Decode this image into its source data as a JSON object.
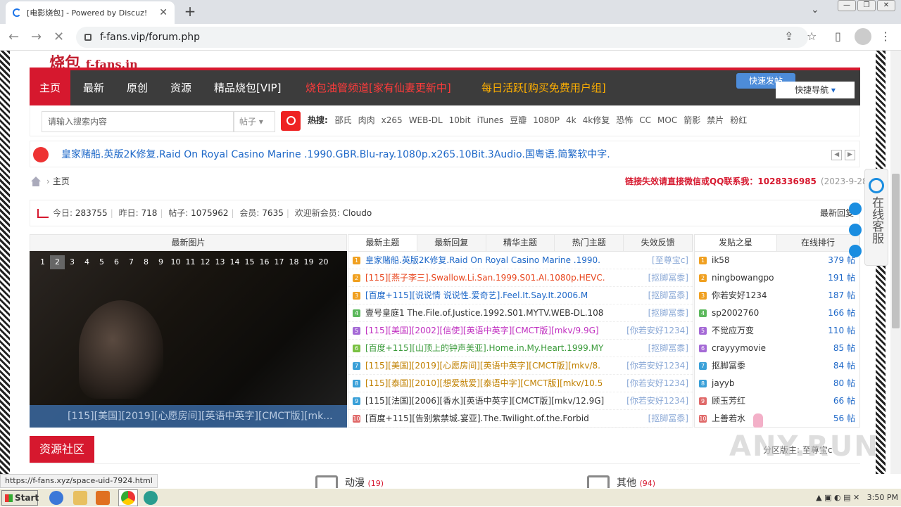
{
  "browser": {
    "tab_title": "[电影烧包] - Powered by Discuz!",
    "url": "f-fans.vip/forum.php",
    "status_url": "https://f-fans.xyz/space-uid-7924.html"
  },
  "site": {
    "logo_cn": "烧包",
    "logo_en": "f-fans.in"
  },
  "nav": {
    "items": [
      "主页",
      "最新",
      "原创",
      "资源",
      "精品烧包[VIP]"
    ],
    "promo1": "烧包油管频道[家有仙妻更新中]",
    "promo2": "每日活跃[购买免费用户组]",
    "quick_post": "快速发帖",
    "quick_nav": "快捷导航"
  },
  "search": {
    "placeholder": "请输入搜索内容",
    "type": "帖子",
    "hot_label": "热搜:",
    "hot": [
      "邵氏",
      "肉肉",
      "x265",
      "WEB-DL",
      "10bit",
      "iTunes",
      "豆瓣",
      "1080P",
      "4k",
      "4k修复",
      "恐怖",
      "CC",
      "MOC",
      "箭影",
      "禁片",
      "粉红"
    ]
  },
  "notice": "皇家赌船.英版2K修复.Raid On Royal Casino Marine .1990.GBR.Blu-ray.1080p.x265.10Bit.3Audio.国粤语.简繁软中字.",
  "breadcrumb": "主页",
  "contact": {
    "text": "链接失效请直接微信或QQ联系我：1028336985",
    "date": "(2023-9-28)"
  },
  "stats": {
    "today_label": "今日:",
    "today": "283755",
    "yesterday_label": "昨日:",
    "yesterday": "718",
    "posts_label": "帖子:",
    "posts": "1075962",
    "members_label": "会员:",
    "members": "7635",
    "welcome_label": "欢迎新会员:",
    "welcome": "Cloudo",
    "right": "最新回复"
  },
  "pics": {
    "header": "最新图片",
    "pages": [
      "1",
      "2",
      "3",
      "4",
      "5",
      "6",
      "7",
      "8",
      "9",
      "10",
      "11",
      "12",
      "13",
      "14",
      "15",
      "16",
      "17",
      "18",
      "19",
      "20"
    ],
    "current_page": "2",
    "caption": "[115][美国][2019][心愿房间][英语中英字][CMCT版][mk..."
  },
  "threads": {
    "tabs": [
      "最新主题",
      "最新回复",
      "精华主题",
      "热门主题",
      "失效反馈"
    ],
    "rows": [
      {
        "n": "1",
        "title": "皇家赌船.英版2K修复.Raid On Royal Casino Marine .1990.",
        "author": "[至尊宝c]",
        "color": "#1e68c8",
        "badge": "#f0a020"
      },
      {
        "n": "2",
        "title": "[115][燕子李三].Swallow.Li.San.1999.S01.AI.1080p.HEVC.",
        "author": "[抠脚冨黍]",
        "color": "#e8461e",
        "badge": "#f0a020"
      },
      {
        "n": "3",
        "title": "[百度+115][说说情 说说性.爱奇艺].Feel.It.Say.It.2006.M",
        "author": "[抠脚冨黍]",
        "color": "#1e68c8",
        "badge": "#f0a020"
      },
      {
        "n": "4",
        "title": "壹号皇庭1 The.File.of.Justice.1992.S01.MYTV.WEB-DL.108",
        "author": "[抠脚冨黍]",
        "color": "#333333",
        "badge": "#5cb85c"
      },
      {
        "n": "5",
        "title": "[115][美国][2002][信使][英语中英字][CMCT版][mkv/9.9G]",
        "author": "[你若安好1234]",
        "color": "#c02fc0",
        "badge": "#a56ad6"
      },
      {
        "n": "6",
        "title": "[百度+115][山顶上的钟声美亚].Home.in.My.Heart.1999.MY",
        "author": "[抠脚冨黍]",
        "color": "#3a9a3a",
        "badge": "#7ac143"
      },
      {
        "n": "7",
        "title": "[115][美国][2019][心愿房间][英语中英字][CMCT版][mkv/8.",
        "author": "[你若安好1234]",
        "color": "#c08000",
        "badge": "#3aa0d8"
      },
      {
        "n": "8",
        "title": "[115][泰国][2010][想爱就爱][泰语中字][CMCT版][mkv/10.5",
        "author": "[你若安好1234]",
        "color": "#c08000",
        "badge": "#3aa0d8"
      },
      {
        "n": "9",
        "title": "[115][法国][2006][香水][英语中英字][CMCT版][mkv/12.9G]",
        "author": "[你若安好1234]",
        "color": "#333333",
        "badge": "#3aa0d8"
      },
      {
        "n": "10",
        "title": "[百度+115][告别紫禁城.宴亚].The.Twilight.of.the.Forbid",
        "author": "[抠脚冨黍]",
        "color": "#333333",
        "badge": "#e06a6a"
      }
    ]
  },
  "users": {
    "tabs": [
      "发贴之星",
      "在线排行"
    ],
    "rows": [
      {
        "n": "1",
        "name": "ik58",
        "count": "379 帖",
        "badge": "#f0a020"
      },
      {
        "n": "2",
        "name": "ningbowangpo",
        "count": "191 帖",
        "badge": "#f0a020"
      },
      {
        "n": "3",
        "name": "你若安好1234",
        "count": "187 帖",
        "badge": "#f0a020"
      },
      {
        "n": "4",
        "name": "sp2002760",
        "count": "166 帖",
        "badge": "#5cb85c"
      },
      {
        "n": "5",
        "name": "不觉应万变",
        "count": "110 帖",
        "badge": "#a56ad6"
      },
      {
        "n": "6",
        "name": "crayyymovie",
        "count": "85 帖",
        "badge": "#a56ad6"
      },
      {
        "n": "7",
        "name": "抠脚冨黍",
        "count": "84 帖",
        "badge": "#3aa0d8"
      },
      {
        "n": "8",
        "name": "jayyb",
        "count": "80 帖",
        "badge": "#3aa0d8"
      },
      {
        "n": "9",
        "name": "顾玉芳红",
        "count": "66 帖",
        "badge": "#e06a6a"
      },
      {
        "n": "10",
        "name": "上善若水",
        "count": "56 帖",
        "badge": "#e06a6a"
      }
    ]
  },
  "resources": {
    "title": "资源社区",
    "moderator": "分区版主: 至尊宝c",
    "cat1": "动漫",
    "cat1_count": "(19)",
    "cat2": "其他",
    "cat2_count": "(94)"
  },
  "side": {
    "service": "在线客服"
  },
  "taskbar": {
    "start": "Start",
    "time": "3:50 PM"
  },
  "watermark": "ANY.RUN"
}
